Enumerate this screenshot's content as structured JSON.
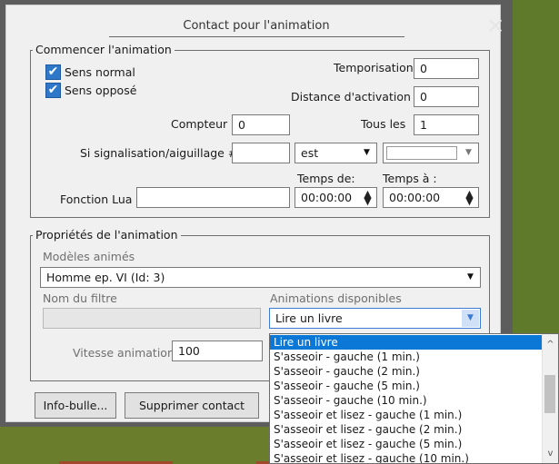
{
  "dialog": {
    "title": "Contact pour l'animation",
    "close_glyph": "✕"
  },
  "start_group": {
    "legend": "Commencer l'animation",
    "sens_normal": {
      "label": "Sens normal",
      "checked": true
    },
    "sens_oppose": {
      "label": "Sens opposé",
      "checked": true
    },
    "temporisation": {
      "label": "Temporisation",
      "value": "0"
    },
    "distance": {
      "label": "Distance d'activation",
      "value": "0"
    },
    "compteur": {
      "label": "Compteur",
      "value": "0"
    },
    "tous_les": {
      "label": "Tous les",
      "value": "1"
    },
    "signal": {
      "label": "Si signalisation/aiguillage #",
      "value": "",
      "operator": "est",
      "state": ""
    },
    "temps_de": {
      "label": "Temps de:",
      "value": "00:00:00"
    },
    "temps_a": {
      "label": "Temps à :",
      "value": "00:00:00"
    },
    "lua": {
      "label": "Fonction Lua",
      "value": ""
    }
  },
  "props_group": {
    "legend": "Propriétés de l'animation",
    "models_label": "Modèles animés",
    "model_selected": "Homme ep. VI (Id: 3)",
    "filter_label": "Nom du filtre",
    "filter_value": "",
    "anims_label": "Animations disponibles",
    "anim_selected": "Lire un livre",
    "speed": {
      "label": "Vitesse animation",
      "value": "100"
    }
  },
  "buttons": {
    "info": "Info-bulle...",
    "delete": "Supprimer contact"
  },
  "dropdown_options": [
    "Lire un livre",
    "S'asseoir - gauche (1 min.)",
    "S'asseoir - gauche (2 min.)",
    "S'asseoir - gauche (5 min.)",
    "S'asseoir - gauche (10 min.)",
    "S'asseoir et lisez - gauche (1 min.)",
    "S'asseoir et lisez - gauche (2 min.)",
    "S'asseoir et lisez - gauche (5 min.)",
    "S'asseoir et lisez - gauche (10 min.)"
  ],
  "icons": {
    "check": "✔",
    "arrow_down": "▼",
    "spin_up": "▲",
    "spin_down": "▼",
    "scroll_up": "^",
    "scroll_down": "v"
  },
  "colors": {
    "selection": "#0b78d7",
    "checkbox": "#2f78c9",
    "dialog_frame": "#5d5d5d",
    "background_green": "#6a7d2c"
  }
}
